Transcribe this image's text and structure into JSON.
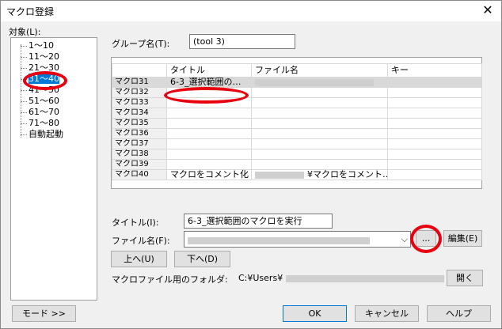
{
  "window": {
    "title": "マクロ登録",
    "close": "✕"
  },
  "target": {
    "label": "対象(L):",
    "nodes": [
      "1〜10",
      "11〜20",
      "21〜30",
      "31〜40",
      "41〜50",
      "51〜60",
      "61〜70",
      "71〜80",
      "自動起動"
    ],
    "selected_index": 3
  },
  "group": {
    "label": "グループ名(T):",
    "value": "(tool 3)"
  },
  "grid": {
    "headers": [
      "",
      "タイトル",
      "ファイル名",
      "キー"
    ],
    "rows": [
      {
        "name": "マクロ31",
        "title": "6-3_選択範囲の…",
        "file": "",
        "key": ""
      },
      {
        "name": "マクロ32",
        "title": "",
        "file": "",
        "key": ""
      },
      {
        "name": "マクロ33",
        "title": "",
        "file": "",
        "key": ""
      },
      {
        "name": "マクロ34",
        "title": "",
        "file": "",
        "key": ""
      },
      {
        "name": "マクロ35",
        "title": "",
        "file": "",
        "key": ""
      },
      {
        "name": "マクロ36",
        "title": "",
        "file": "",
        "key": ""
      },
      {
        "name": "マクロ37",
        "title": "",
        "file": "",
        "key": ""
      },
      {
        "name": "マクロ38",
        "title": "",
        "file": "",
        "key": ""
      },
      {
        "name": "マクロ39",
        "title": "",
        "file": "",
        "key": ""
      },
      {
        "name": "マクロ40",
        "title": "マクロをコメント化",
        "file": "¥マクロをコメント…",
        "key": ""
      }
    ]
  },
  "title_field": {
    "label": "タイトル(I):",
    "value": "6-3_選択範囲のマクロを実行"
  },
  "file_field": {
    "label": "ファイル名(F):",
    "value": "",
    "browse": "...",
    "edit": "編集(E)"
  },
  "move": {
    "up": "上へ(U)",
    "down": "下へ(D)"
  },
  "folder": {
    "label": "マクロファイル用のフォルダ:",
    "value": "C:¥Users¥",
    "open": "開く"
  },
  "footer": {
    "mode": "モード >>",
    "ok": "OK",
    "cancel": "キャンセル",
    "help": "ヘルプ"
  },
  "colors": {
    "selection": "#0078d7",
    "annotation": "#e8000f"
  }
}
